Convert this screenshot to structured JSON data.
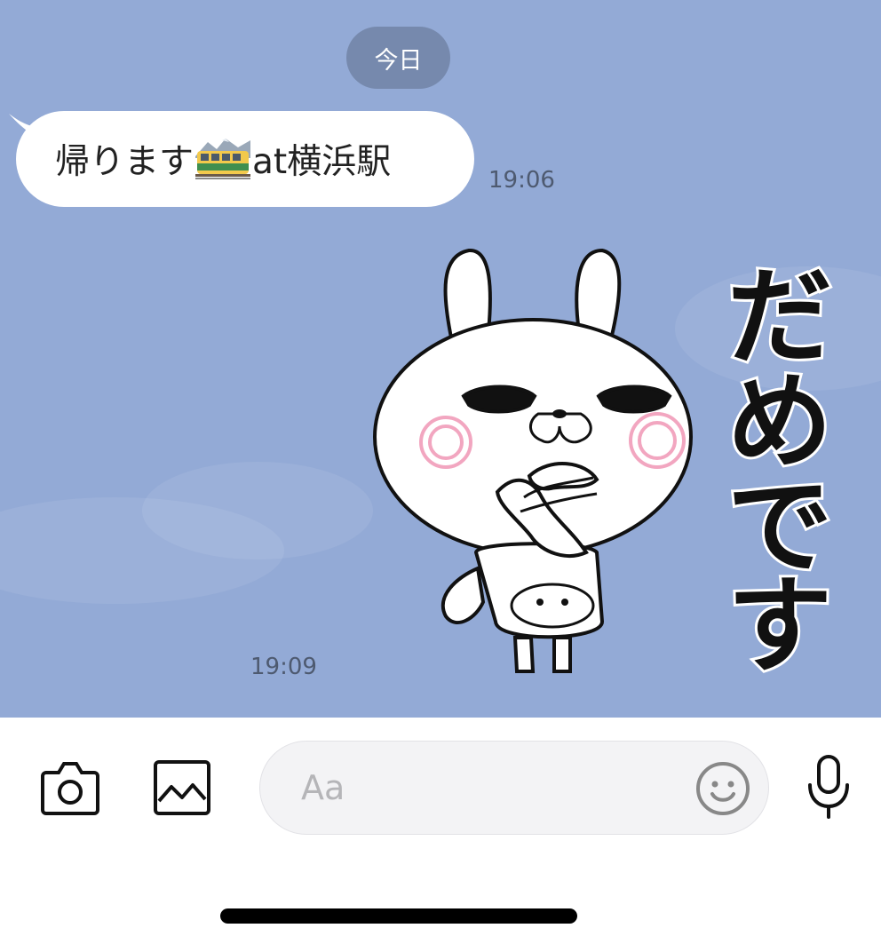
{
  "chat": {
    "date_chip": "今日",
    "messages": [
      {
        "text_before": "帰ります",
        "emoji": "train-emoji",
        "text_after": "at横浜駅",
        "time": "19:06"
      },
      {
        "sticker": "rabbit-sticker",
        "sticker_text": "だめです",
        "time": "19:09"
      }
    ]
  },
  "input_bar": {
    "placeholder": "Aa",
    "icons": [
      "camera-icon",
      "image-icon",
      "smiley-icon",
      "microphone-icon"
    ]
  },
  "colors": {
    "chat_background": "#93aad6",
    "date_chip": "#7689ad",
    "bubble": "#ffffff",
    "input_background": "#f3f3f5"
  }
}
